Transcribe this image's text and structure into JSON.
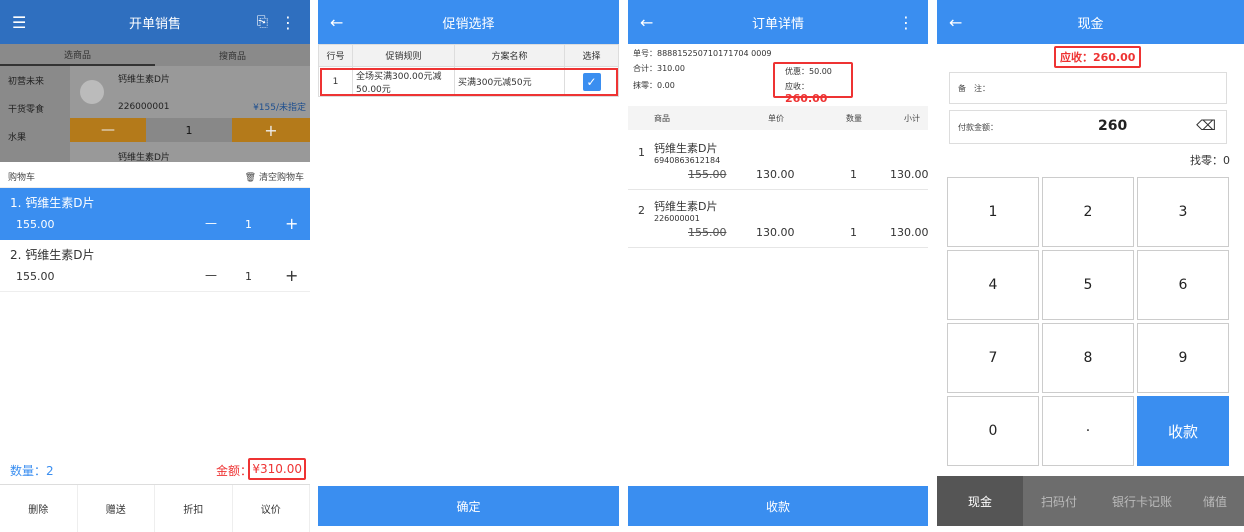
{
  "panel1": {
    "title": "开单销售",
    "tabs": [
      "选商品",
      "搜商品"
    ],
    "categories": [
      "初营未来",
      "干货零食",
      "水果"
    ],
    "product": {
      "name": "钙维生素D片",
      "code": "226000001",
      "price": "¥155/未指定",
      "qty": "1",
      "name2": "钙维生素D片"
    },
    "cart_label": "购物车",
    "clear_cart": "清空购物车",
    "cart_items": [
      {
        "name": "1. 钙维生素D片",
        "price": "155.00",
        "qty": "1"
      },
      {
        "name": "2. 钙维生素D片",
        "price": "155.00",
        "qty": "1"
      }
    ],
    "count_label": "数量：2",
    "amount_label": "金额：",
    "amount_value": "¥310.00",
    "buttons": [
      "删除",
      "赠送",
      "折扣",
      "议价"
    ]
  },
  "panel2": {
    "title": "促销选择",
    "headers": [
      "行号",
      "促销规则",
      "方案名称",
      "选择"
    ],
    "rows": [
      {
        "no": "1",
        "rule": "全场买满300.00元减50.00元",
        "name": "买满300元减50元"
      }
    ],
    "confirm": "确定"
  },
  "panel3": {
    "title": "订单详情",
    "order_no": "单号：888815250710171704 0009",
    "total": "合计：310.00",
    "round": "抹零：0.00",
    "discount": "优惠：50.00",
    "receivable_label": "应收：",
    "receivable_value": "260.00",
    "headers": [
      "商品",
      "单价",
      "数量",
      "小计"
    ],
    "items": [
      {
        "no": "1",
        "name": "钙维生素D片",
        "code": "6940863612184",
        "orig": "155.00",
        "price": "130.00",
        "qty": "1",
        "sub": "130.00"
      },
      {
        "no": "2",
        "name": "钙维生素D片",
        "code": "226000001",
        "orig": "155.00",
        "price": "130.00",
        "qty": "1",
        "sub": "130.00"
      }
    ],
    "collect": "收款"
  },
  "panel4": {
    "title": "现金",
    "receivable": "应收：260.00",
    "note_label": "备　注：",
    "pay_label": "付款金额：",
    "pay_value": "260",
    "change": "找零：0",
    "keys": [
      "1",
      "2",
      "3",
      "4",
      "5",
      "6",
      "7",
      "8",
      "9",
      "0",
      "·",
      "收款"
    ],
    "tabs": [
      "现金",
      "扫码付",
      "银行卡记账",
      "储值"
    ]
  }
}
